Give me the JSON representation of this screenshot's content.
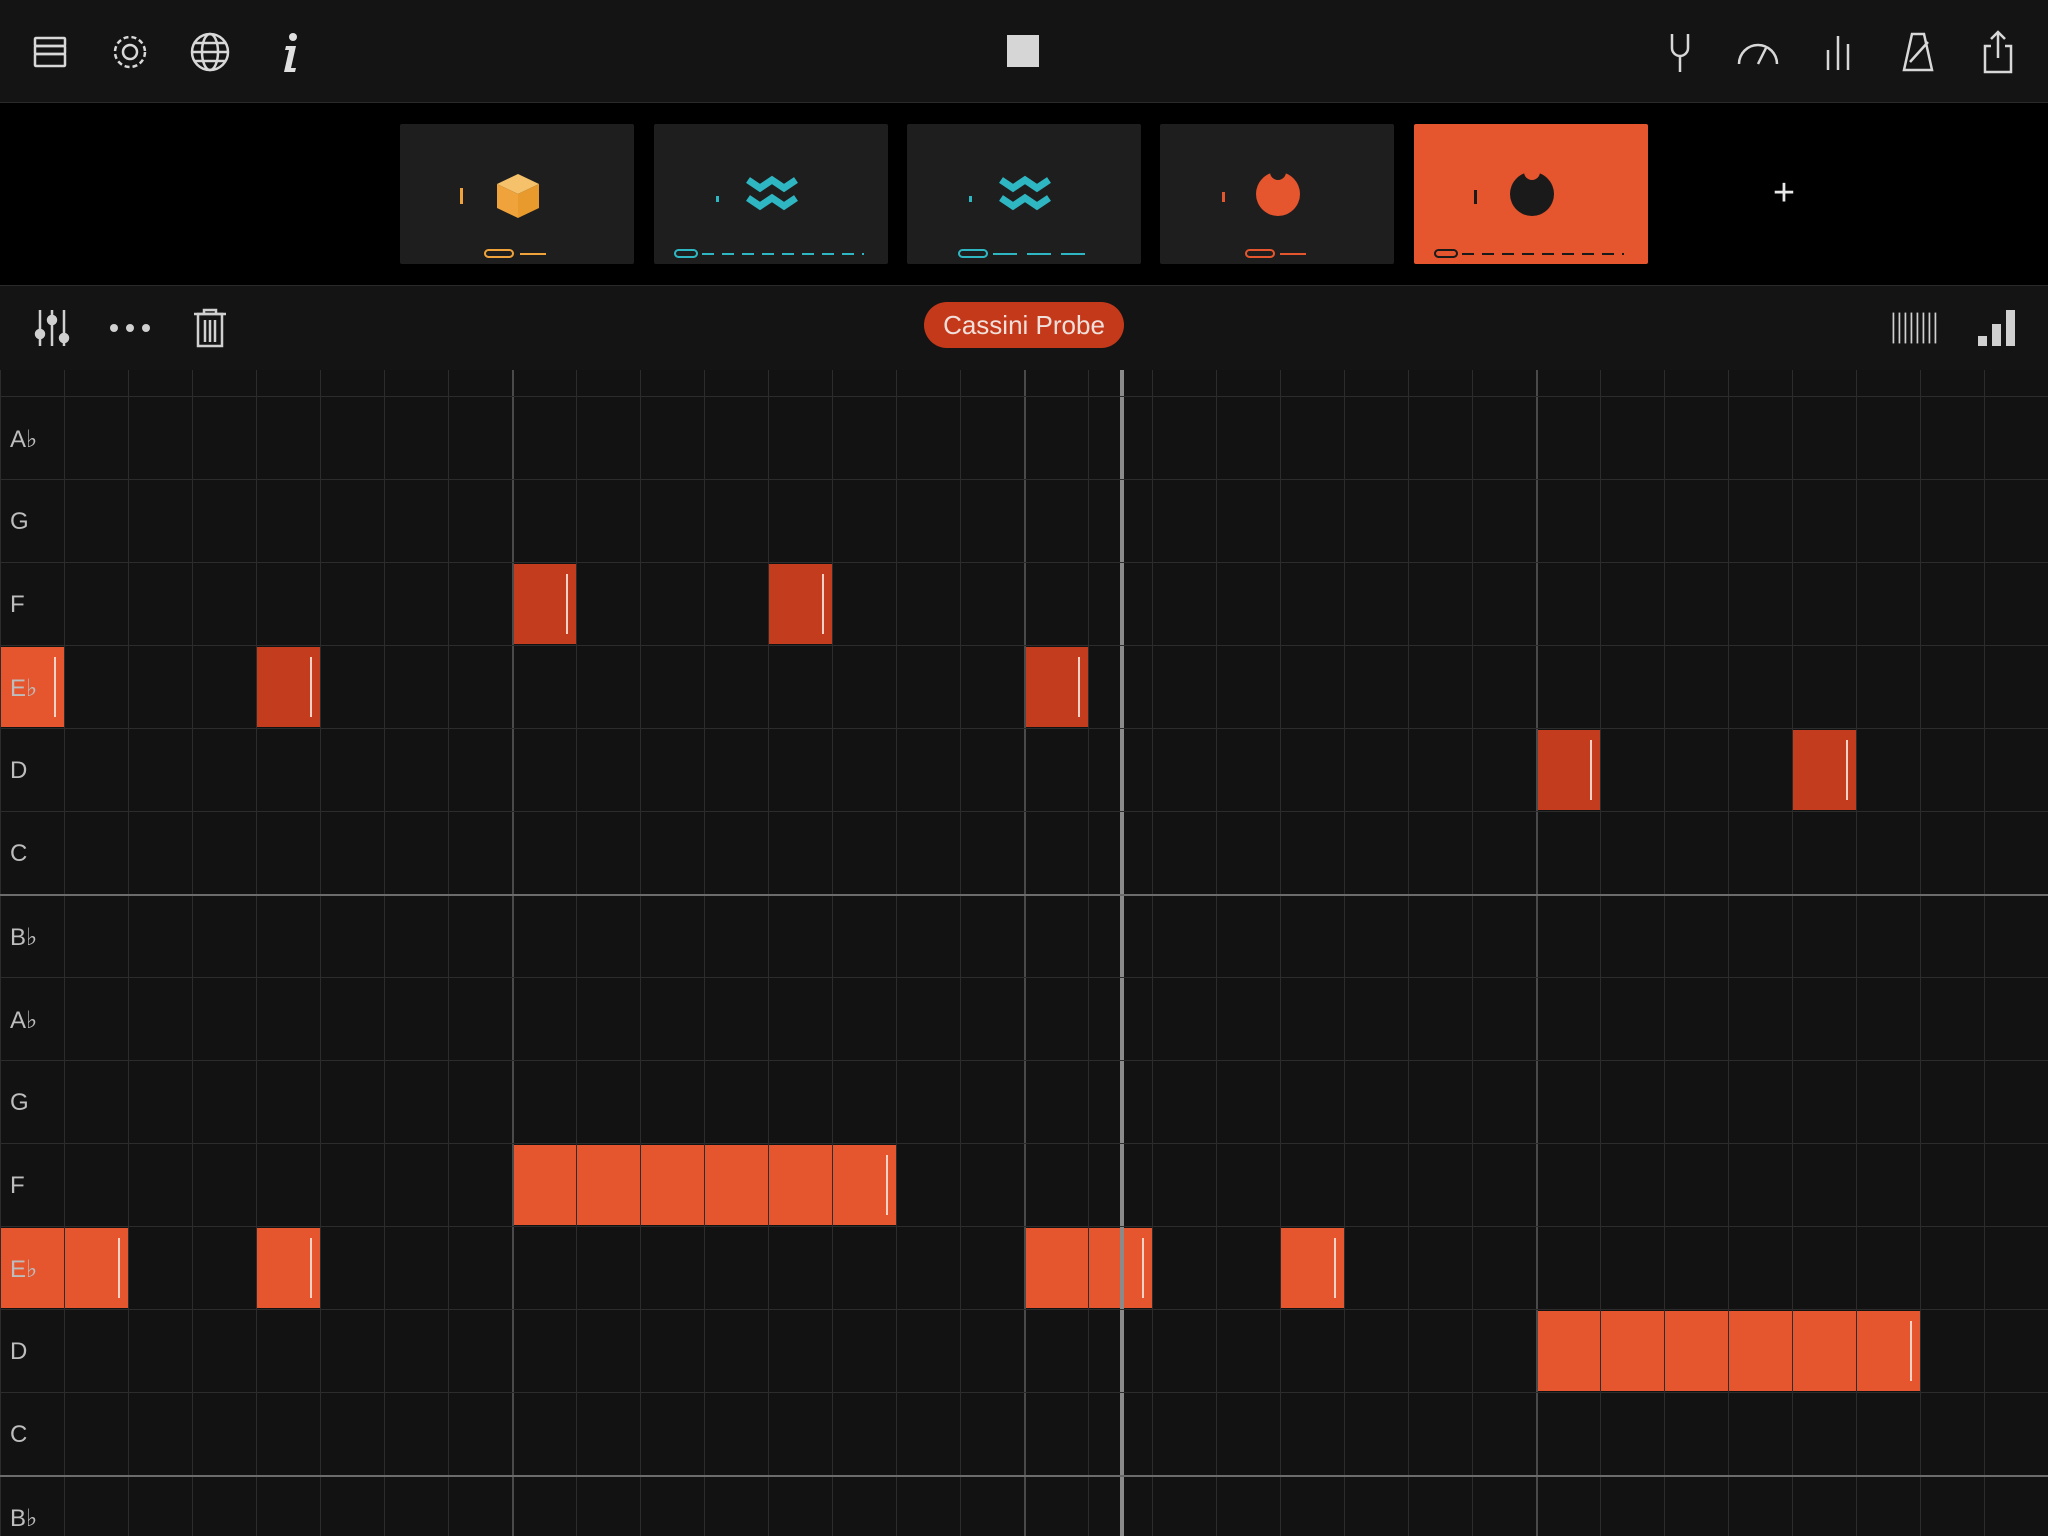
{
  "app": {
    "accent_color": "#e5552e",
    "accent_dark": "#c23c1d"
  },
  "toolbar_top": {
    "left_icons": [
      "library-icon",
      "settings-icon",
      "globe-icon",
      "info-icon"
    ],
    "center_icon": "stop-icon",
    "right_icons": [
      "tuning-fork-icon",
      "tempo-gauge-icon",
      "mixer-icon",
      "metronome-icon",
      "share-icon"
    ]
  },
  "tracks": [
    {
      "icon": "cube-icon",
      "color": "#f0a23b",
      "active": false
    },
    {
      "icon": "wave-icon",
      "color": "#2eb7c2",
      "active": false
    },
    {
      "icon": "wave-icon",
      "color": "#2eb7c2",
      "active": false
    },
    {
      "icon": "drop-icon",
      "color": "#e5552e",
      "active": false
    },
    {
      "icon": "drop-icon",
      "color": "#1a1a1a",
      "active": true
    }
  ],
  "add_track_label": "+",
  "editor_toolbar": {
    "left_icons": [
      "sliders-icon",
      "more-icon",
      "trash-icon"
    ],
    "preset_name": "Cassini Probe",
    "right_icons": [
      "steps-grid-icon",
      "velocity-bars-icon"
    ]
  },
  "piano_roll": {
    "note_labels": [
      "A♭",
      "G",
      "F",
      "E♭",
      "D",
      "C",
      "B♭",
      "A♭",
      "G",
      "F",
      "E♭",
      "D",
      "C",
      "B♭"
    ],
    "notes": [
      {
        "pitch": "E♭",
        "octave": "upper",
        "start_step": 0,
        "length_steps": 1,
        "tone": "light"
      },
      {
        "pitch": "E♭",
        "octave": "upper",
        "start_step": 4,
        "length_steps": 1,
        "tone": "dark"
      },
      {
        "pitch": "F",
        "octave": "upper",
        "start_step": 8,
        "length_steps": 1,
        "tone": "dark"
      },
      {
        "pitch": "F",
        "octave": "upper",
        "start_step": 12,
        "length_steps": 1,
        "tone": "dark"
      },
      {
        "pitch": "E♭",
        "octave": "upper",
        "start_step": 16,
        "length_steps": 1,
        "tone": "dark"
      },
      {
        "pitch": "D",
        "octave": "upper",
        "start_step": 24,
        "length_steps": 1,
        "tone": "dark"
      },
      {
        "pitch": "D",
        "octave": "upper",
        "start_step": 28,
        "length_steps": 1,
        "tone": "dark"
      },
      {
        "pitch": "E♭",
        "octave": "lower",
        "start_step": 0,
        "length_steps": 2,
        "tone": "light"
      },
      {
        "pitch": "E♭",
        "octave": "lower",
        "start_step": 4,
        "length_steps": 1,
        "tone": "light"
      },
      {
        "pitch": "F",
        "octave": "lower",
        "start_step": 8,
        "length_steps": 6,
        "tone": "light"
      },
      {
        "pitch": "E♭",
        "octave": "lower",
        "start_step": 16,
        "length_steps": 2,
        "tone": "light"
      },
      {
        "pitch": "E♭",
        "octave": "lower",
        "start_step": 20,
        "length_steps": 1,
        "tone": "light"
      },
      {
        "pitch": "D",
        "octave": "lower",
        "start_step": 24,
        "length_steps": 6,
        "tone": "light"
      }
    ]
  }
}
